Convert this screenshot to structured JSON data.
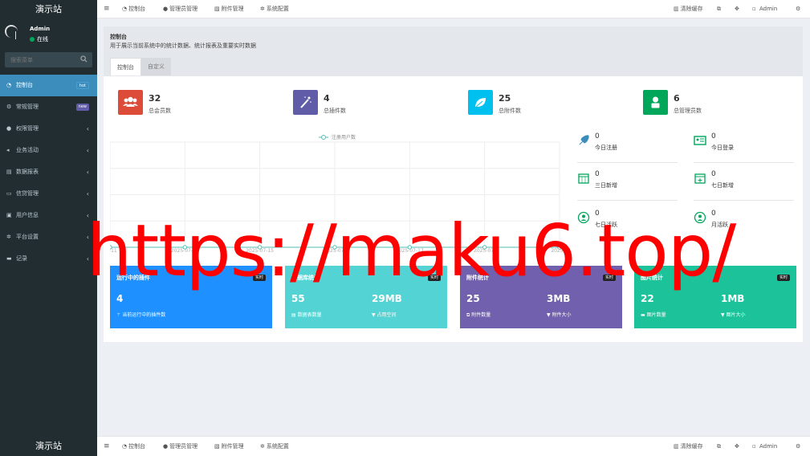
{
  "brand": "演示站",
  "user": {
    "name": "Admin",
    "status": "在线"
  },
  "sidebar": {
    "search_placeholder": "搜索菜单",
    "items": [
      {
        "label": "控制台",
        "icon": "dashboard-icon",
        "badge": "hot",
        "active": true
      },
      {
        "label": "常规管理",
        "icon": "gears-icon",
        "badge": "new"
      },
      {
        "label": "权限管理",
        "icon": "group-icon",
        "chevron": "‹"
      },
      {
        "label": "业务活动",
        "icon": "bullhorn-icon",
        "chevron": "‹"
      },
      {
        "label": "数据报表",
        "icon": "chart-icon",
        "chevron": "‹"
      },
      {
        "label": "信贷管理",
        "icon": "card-icon",
        "chevron": "‹"
      },
      {
        "label": "用户信息",
        "icon": "user-icon",
        "chevron": "‹"
      },
      {
        "label": "平台设置",
        "icon": "cog-icon",
        "chevron": "‹"
      },
      {
        "label": "记录",
        "icon": "records-icon",
        "chevron": "‹"
      }
    ]
  },
  "topbar": {
    "nav": [
      "控制台",
      "管理员管理",
      "附件管理",
      "系统配置"
    ],
    "clear_cache": "清除缓存",
    "admin": "Admin"
  },
  "content": {
    "title": "控制台",
    "subtitle": "用于展示当前系统中的统计数据、统计报表及重要实时数据",
    "tabs": [
      "控制台",
      "自定义"
    ]
  },
  "stats": [
    {
      "value": "32",
      "label": "总会员数",
      "color": "#dd4b39",
      "icon": "users-icon"
    },
    {
      "value": "4",
      "label": "总插件数",
      "color": "#605ca8",
      "icon": "magic-icon"
    },
    {
      "value": "25",
      "label": "总附件数",
      "color": "#00c0ef",
      "icon": "leaf-icon"
    },
    {
      "value": "6",
      "label": "总管理员数",
      "color": "#00a65a",
      "icon": "user-icon"
    }
  ],
  "chart_data": {
    "type": "line",
    "title": "",
    "series": [
      {
        "name": "注册用户数",
        "values": [
          0,
          0,
          0,
          0,
          0,
          0,
          0
        ]
      }
    ],
    "x": [
      "2025-07-11",
      "2025-07-12",
      "2025-07-13",
      "2025-07-14",
      "2025-07-15",
      "2025-07-16",
      "2025-07-17"
    ],
    "tick_labels": [
      "07-11",
      "2025-07-13",
      "2025-07-15",
      "2025-07-",
      "2025-07-17",
      "2025-07-",
      "2025-0"
    ],
    "legend": "top-center",
    "grid": true,
    "color": "#4fc1b6"
  },
  "mini_stats": [
    {
      "value": "0",
      "label": "今日注册",
      "icon": "rocket-icon"
    },
    {
      "value": "0",
      "label": "今日登录",
      "icon": "vcard-icon"
    },
    {
      "value": "0",
      "label": "三日新增",
      "icon": "calendar-icon"
    },
    {
      "value": "0",
      "label": "七日新增",
      "icon": "calendar-plus-icon"
    },
    {
      "value": "0",
      "label": "七日活跃",
      "icon": "user-circle-icon"
    },
    {
      "value": "0",
      "label": "月活跃",
      "icon": "user-circle-icon"
    }
  ],
  "cards": [
    {
      "title": "运行中的插件",
      "tag": "实时",
      "v1": "4",
      "l1": "当前运行中的插件数",
      "color": "#1e90ff"
    },
    {
      "title": "数据库统计",
      "tag": "实时",
      "v1": "55",
      "l1": "数据表数量",
      "v2": "29MB",
      "l2": "占用空间",
      "color": "#53d3d3"
    },
    {
      "title": "附件统计",
      "tag": "实时",
      "v1": "25",
      "l1": "附件数量",
      "v2": "3MB",
      "l2": "附件大小",
      "color": "#7060ad"
    },
    {
      "title": "图片统计",
      "tag": "实时",
      "v1": "22",
      "l1": "图片数量",
      "v2": "1MB",
      "l2": "图片大小",
      "color": "#1bc29a"
    }
  ],
  "watermark": "https://maku6.top/"
}
